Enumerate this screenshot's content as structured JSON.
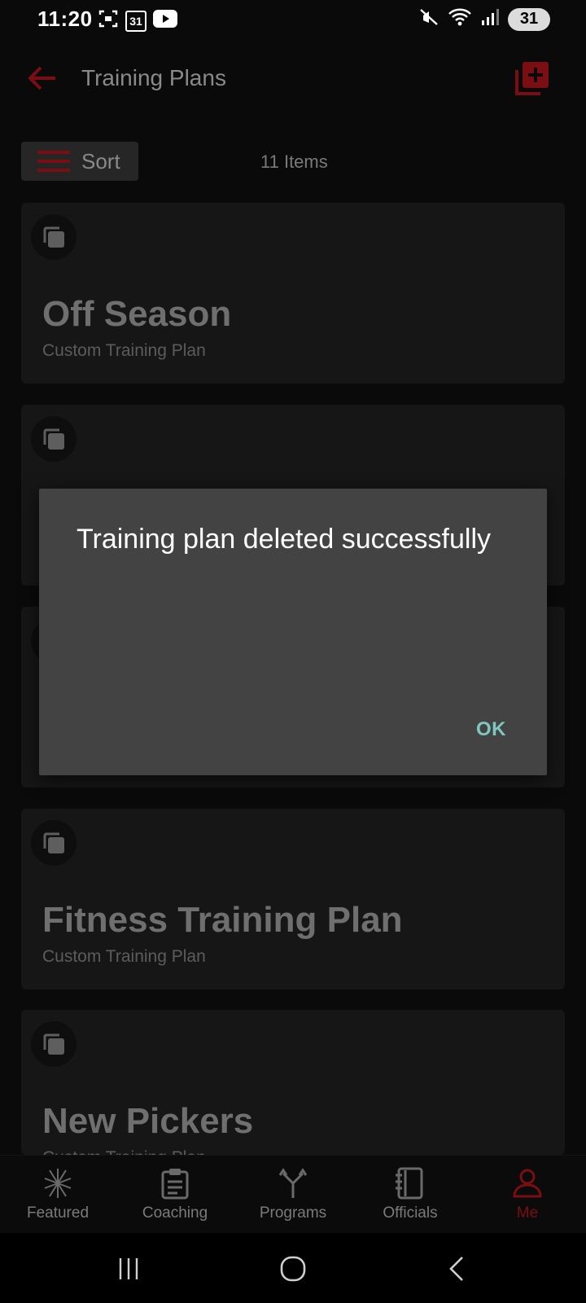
{
  "status_bar": {
    "time": "11:20",
    "calendar_day": "31",
    "battery": "31",
    "icons": [
      "screenshot-icon",
      "calendar-icon",
      "youtube-icon",
      "mute-icon",
      "wifi-icon",
      "signal-icon",
      "battery-icon"
    ]
  },
  "header": {
    "title": "Training Plans",
    "accent_color": "#7a0e12"
  },
  "sort": {
    "label": "Sort",
    "items_count": "11 Items"
  },
  "cards": [
    {
      "title": "Off Season",
      "subtitle": "Custom Training Plan"
    },
    {
      "title": "",
      "subtitle": ""
    },
    {
      "title": "",
      "subtitle": ""
    },
    {
      "title": "Fitness Training Plan",
      "subtitle": "Custom Training Plan"
    },
    {
      "title": "New Pickers",
      "subtitle": "Custom Training Plan"
    }
  ],
  "dialog": {
    "message": "Training plan deleted successfully",
    "ok_label": "OK",
    "ok_color": "#7fc8c0"
  },
  "bottom_nav": {
    "items": [
      {
        "label": "Featured",
        "icon": "featured-icon"
      },
      {
        "label": "Coaching",
        "icon": "clipboard-icon"
      },
      {
        "label": "Programs",
        "icon": "programs-icon"
      },
      {
        "label": "Officials",
        "icon": "book-icon"
      },
      {
        "label": "Me",
        "icon": "person-icon",
        "active": true
      }
    ]
  }
}
